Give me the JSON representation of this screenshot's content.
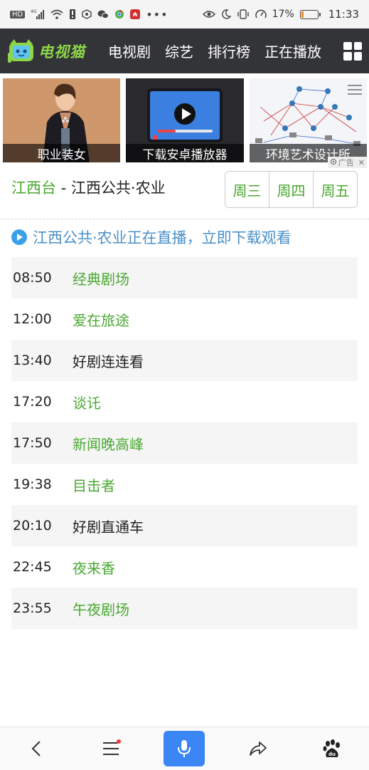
{
  "status_bar": {
    "hd_label": "HD",
    "network": "4G",
    "battery_percent": "17%",
    "battery_level": 0.17,
    "time": "11:33"
  },
  "navbar": {
    "logo_text": "电视猫",
    "items": [
      "电视剧",
      "综艺",
      "排行榜",
      "正在播放"
    ]
  },
  "ads": [
    {
      "label": "职业装女"
    },
    {
      "label": "下载安卓播放器"
    },
    {
      "label": "环境艺术设计所"
    }
  ],
  "ad_tag": "广告",
  "channel": {
    "station": "江西台",
    "separator": " - ",
    "name": "江西公共·农业"
  },
  "days": [
    "周三",
    "周四",
    "周五"
  ],
  "live_banner": "江西公共·农业正在直播，立即下载观看",
  "schedule": [
    {
      "time": "08:50",
      "program": "经典剧场",
      "link": true
    },
    {
      "time": "12:00",
      "program": "爱在旅途",
      "link": true
    },
    {
      "time": "13:40",
      "program": "好剧连连看",
      "link": false
    },
    {
      "time": "17:20",
      "program": "谈讬",
      "link": true
    },
    {
      "time": "17:50",
      "program": "新闻晚高峰",
      "link": true
    },
    {
      "time": "19:38",
      "program": "目击者",
      "link": true
    },
    {
      "time": "20:10",
      "program": "好剧直通车",
      "link": false
    },
    {
      "time": "22:45",
      "program": "夜来香",
      "link": true
    },
    {
      "time": "23:55",
      "program": "午夜剧场",
      "link": true
    }
  ],
  "colors": {
    "accent_green": "#4aa832",
    "navbar_bg": "#333437",
    "live_blue": "#4a90c8",
    "mic_blue": "#3a86f5"
  },
  "bottom_bar": {
    "icons": [
      "back-icon",
      "menu-icon",
      "mic-icon",
      "share-icon",
      "baidu-paw-icon"
    ]
  }
}
